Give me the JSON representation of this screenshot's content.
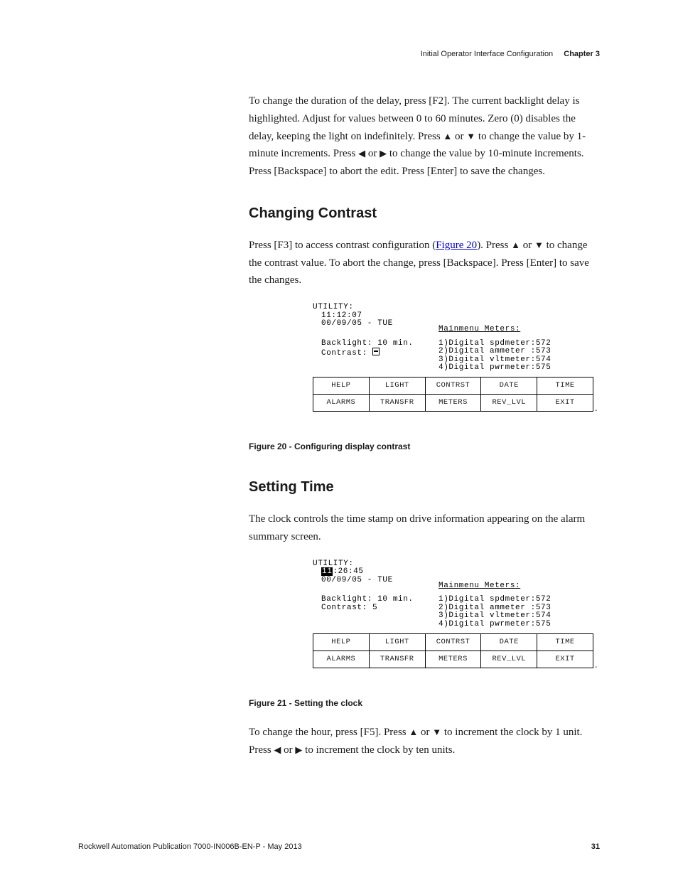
{
  "header": {
    "section": "Initial Operator Interface Configuration",
    "chapter": "Chapter 3"
  },
  "para1_a": "To change the duration of the delay, press [F2]. The current backlight delay is highlighted. Adjust for values between 0 to 60 minutes. Zero (0) disables the delay, keeping the light on indefinitely. Press ",
  "para1_b": " or ",
  "para1_c": " to change the value by 1-minute increments. Press ",
  "para1_d": " or ",
  "para1_e": " to change the value by 10-minute increments. Press [Backspace] to abort the edit. Press [Enter] to save the changes.",
  "h_contrast": "Changing Contrast",
  "para2_a": "Press [F3] to access contrast configuration (",
  "para2_link": "Figure 20",
  "para2_b": "). Press ",
  "para2_c": " or ",
  "para2_d": " to change the contrast value. To abort the change, press [Backspace]. Press [Enter] to save the changes.",
  "screen1": {
    "title": "UTILITY:",
    "time": "11:12:07",
    "date": "00/09/05 - TUE",
    "mm": "Mainmenu Meters:",
    "bl": "Backlight:  10 min.",
    "ct": "Contrast:   ",
    "m1": "1)Digital spdmeter:572",
    "m2": "2)Digital ammeter :573",
    "m3": "3)Digital vltmeter:574",
    "m4": "4)Digital pwrmeter:575",
    "row1": [
      "HELP",
      "LIGHT",
      "CONTRST",
      "DATE",
      "TIME"
    ],
    "row2": [
      "ALARMS",
      "TRANSFR",
      "METERS",
      "REV_LVL",
      "EXIT"
    ]
  },
  "fig20": "Figure 20 - Configuring display contrast",
  "h_time": "Setting Time",
  "para3": "The clock controls the time stamp on drive information appearing on the alarm summary screen.",
  "screen2": {
    "title": "UTILITY:",
    "time_pre": "",
    "time_hh": "11",
    "time_rest": ":26:45",
    "date": "00/09/05 - TUE",
    "mm": "Mainmenu Meters:",
    "bl": "Backlight:  10 min.",
    "ct": "Contrast:    5",
    "m1": "1)Digital spdmeter:572",
    "m2": "2)Digital ammeter :573",
    "m3": "3)Digital vltmeter:574",
    "m4": "4)Digital pwrmeter:575",
    "row1": [
      "HELP",
      "LIGHT",
      "CONTRST",
      "DATE",
      "TIME"
    ],
    "row2": [
      "ALARMS",
      "TRANSFR",
      "METERS",
      "REV_LVL",
      "EXIT"
    ]
  },
  "fig21": "Figure 21 - Setting the clock",
  "para4_a": "To change the hour, press [F5]. Press ",
  "para4_b": " or ",
  "para4_c": " to increment the clock by 1 unit. Press ",
  "para4_d": " or ",
  "para4_e": " to increment the clock by ten units.",
  "footer": {
    "pub": "Rockwell Automation Publication 7000-IN006B-EN-P - May 2013",
    "page": "31"
  }
}
